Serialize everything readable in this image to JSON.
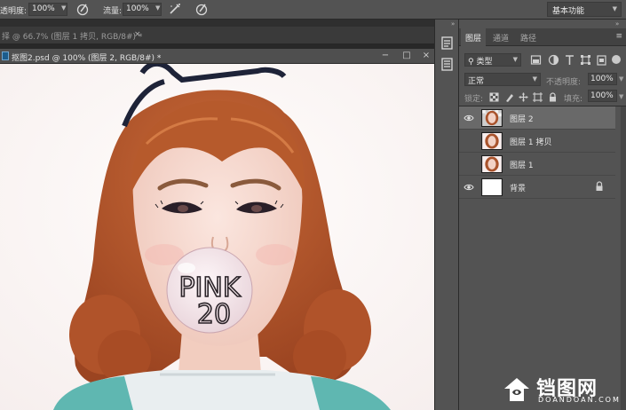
{
  "options_bar": {
    "opacity_label": "透明度:",
    "opacity_value": "100%",
    "flow_label": "流量:",
    "flow_value": "100%",
    "workspace": "基本功能"
  },
  "background_tab": {
    "title": "择 @ 66.7% (图层 1 拷贝, RGB/8#) *",
    "close": "×"
  },
  "document": {
    "title": "抠图2.psd @ 100% (图层 2, RGB/8#) *",
    "minimize": "−",
    "maximize": "□",
    "close": "×"
  },
  "artwork": {
    "badge_line1": "PINK",
    "badge_line2": "20"
  },
  "panel": {
    "collapse": "»",
    "tabs": [
      "图层",
      "通道",
      "路径"
    ],
    "active_tab": 0,
    "menu": "≡",
    "filter_kind": "类型",
    "blend_mode": "正常",
    "opacity_label": "不透明度:",
    "opacity_value": "100%",
    "lock_label": "锁定:",
    "fill_label": "填充:",
    "fill_value": "100%",
    "layers": [
      {
        "name": "图层 2",
        "visible": true,
        "selected": true
      },
      {
        "name": "图层 1 拷贝",
        "visible": false,
        "selected": false
      },
      {
        "name": "图层 1",
        "visible": false,
        "selected": false
      },
      {
        "name": "背景",
        "visible": true,
        "selected": false,
        "locked": true
      }
    ]
  },
  "watermark": {
    "cn": "铛图网",
    "en": "DOANDOAN.COM"
  },
  "colors": {
    "accent_panel": "#535353",
    "selected_layer": "#696969",
    "hair": "#b8582c",
    "sweater": "#5fb7b1"
  }
}
